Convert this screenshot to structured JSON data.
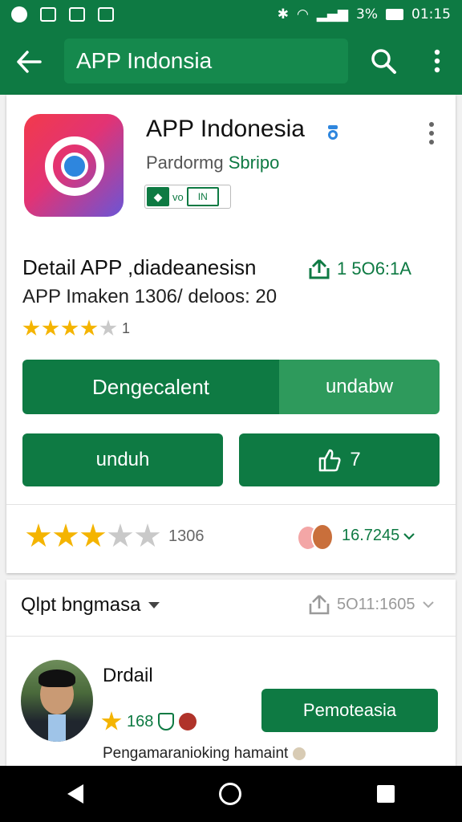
{
  "status_bar": {
    "battery": "3%",
    "time": "01:15"
  },
  "app_bar": {
    "search_text": "APP Indonsia",
    "back_icon": "arrow-left-icon",
    "search_icon": "search-icon",
    "more_icon": "more-vert-icon"
  },
  "app": {
    "title": "APP Indonesia",
    "developer_prefix": "Pardormg",
    "developer_accent": "Sbripo",
    "badge_label": "vo",
    "badge_box": "IN"
  },
  "details": {
    "title": "Detail APP ,diadeanesisn",
    "subtitle": "APP Imaken 1306/ deloos: 20",
    "metric": "1 5O6:1A",
    "rating_count": "1",
    "rating_stars": 4
  },
  "buttons": {
    "install": "Dengecalent",
    "install_alt": "undabw",
    "unduh": "unduh",
    "like_count": "7"
  },
  "ratings": {
    "stars": 3,
    "count": "1306",
    "metric": "16.7245"
  },
  "section": {
    "title": "Qlpt bngmasa",
    "metric": "5O11:1605"
  },
  "review": {
    "name": "Drdail",
    "score": "168",
    "button": "Pemoteasia",
    "text": "Pengamaranioking hamaint"
  },
  "colors": {
    "primary": "#0e7a43",
    "star": "#f4b400"
  }
}
